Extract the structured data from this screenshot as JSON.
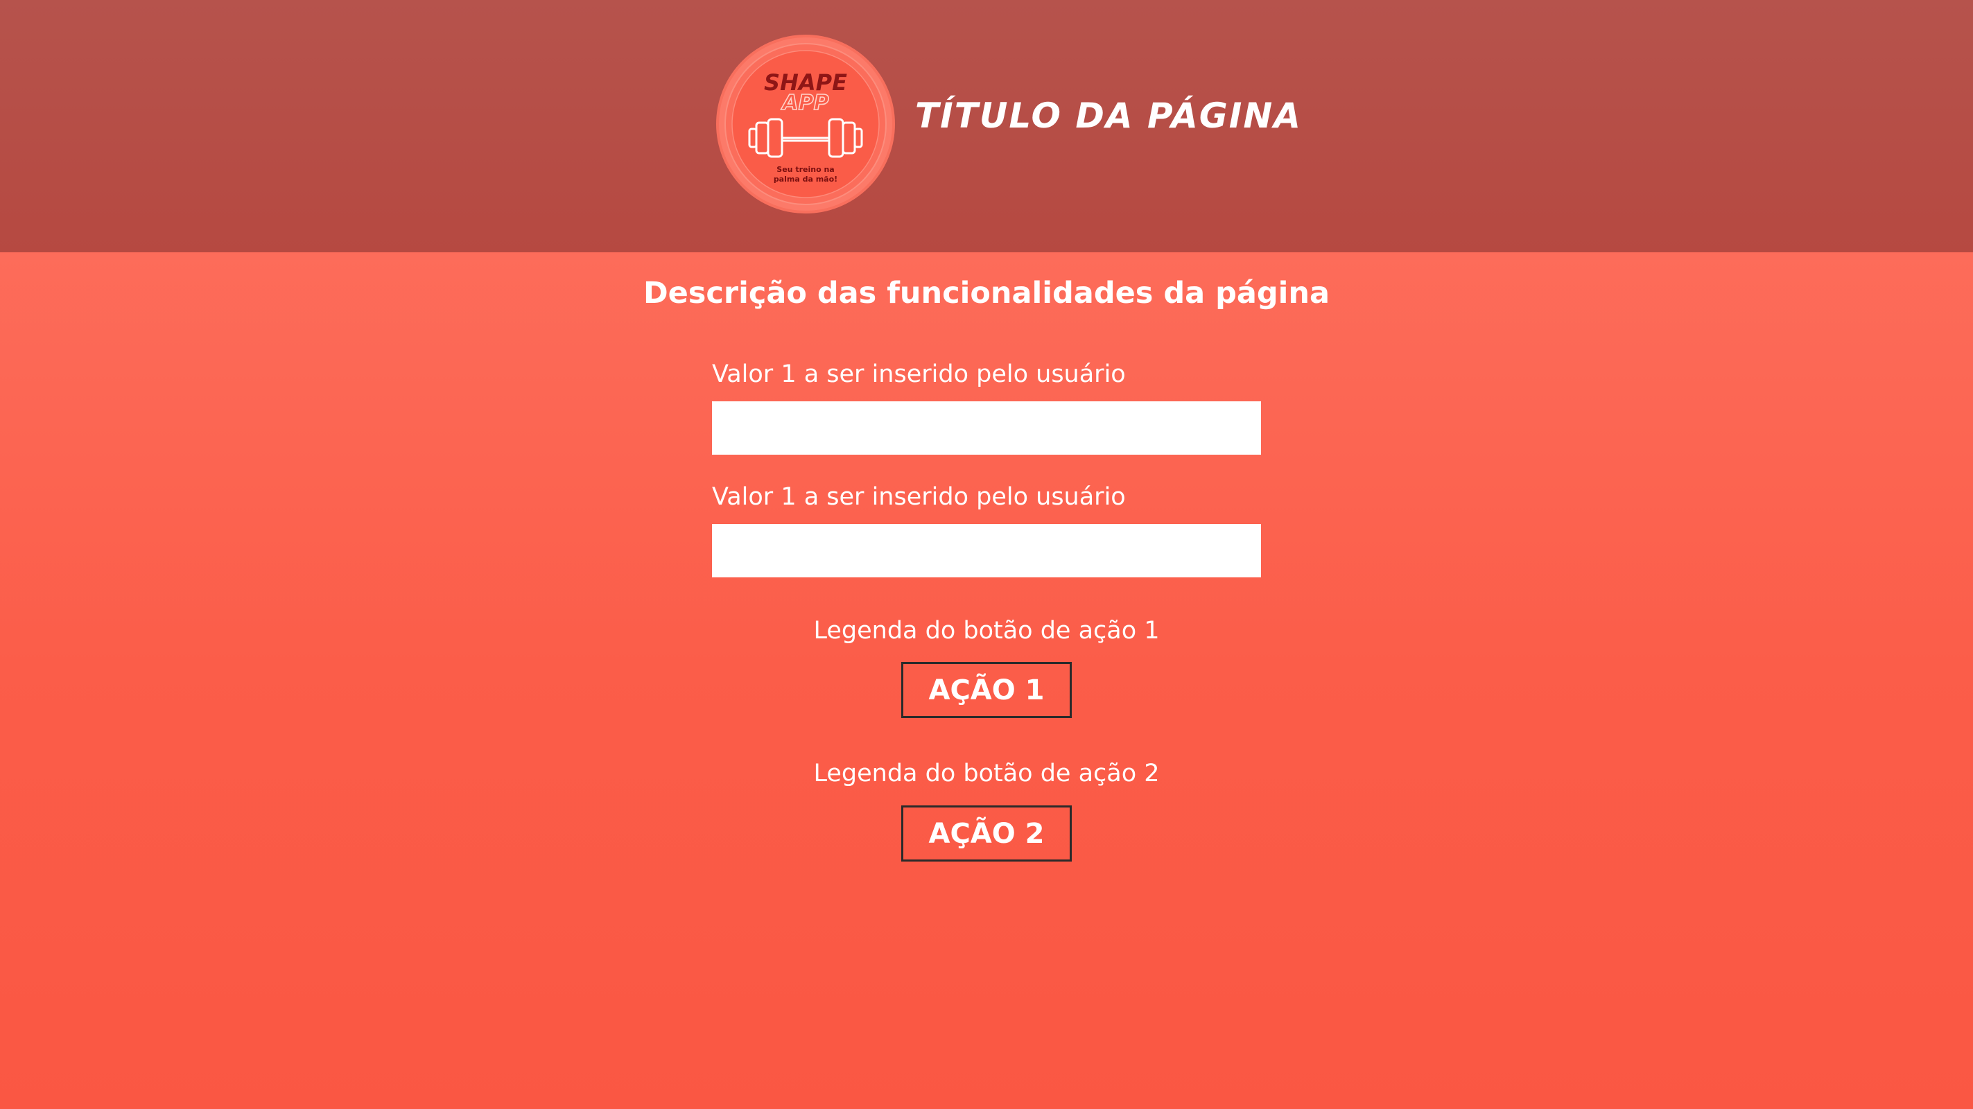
{
  "header": {
    "title": "TÍTULO DA PÁGINA",
    "logo": {
      "line1": "SHAPE",
      "line2": "APP",
      "tagline1": "Seu treino na",
      "tagline2": "palma da mão!",
      "icon": "dumbbell-icon"
    }
  },
  "main": {
    "description": "Descrição das funcionalidades da página",
    "fields": [
      {
        "label": "Valor 1 a ser inserido pelo usuário",
        "value": "",
        "placeholder": ""
      },
      {
        "label": "Valor 1 a ser inserido pelo usuário",
        "value": "",
        "placeholder": ""
      }
    ],
    "actions": [
      {
        "caption": "Legenda do botão de ação 1",
        "label": "AÇÃO 1"
      },
      {
        "caption": "Legenda do botão de ação 2",
        "label": "AÇÃO 2"
      }
    ]
  },
  "colors": {
    "header_background": "#b64d46",
    "page_background_top": "#fe7564",
    "page_background_bottom": "#fa5743",
    "button_border": "#2a2a2a",
    "text": "#ffffff"
  }
}
